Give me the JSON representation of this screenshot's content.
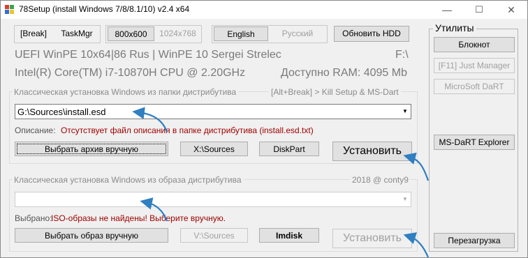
{
  "window": {
    "title": "78Setup (install Windows 7/8/8.1/10) v2.4 x64",
    "minimize_glyph": "—",
    "maximize_glyph": "☐",
    "close_glyph": "✕"
  },
  "toolbar": {
    "break_label": "[Break]",
    "taskmgr_label": "TaskMgr",
    "res1_label": "800x600",
    "res2_label": "1024x768",
    "lang1_label": "English",
    "lang2_label": "Русский",
    "update_hdd_label": "Обновить HDD"
  },
  "info": {
    "line1_left": "UEFI WinPE 10x64|86 Rus | WinPE 10 Sergei Strelec",
    "line1_right": "F:\\",
    "line2_left": "Intel(R) Core(TM) i7-10870H CPU @ 2.20GHz",
    "line2_right": "Доступно RAM: 4095 Mb"
  },
  "folder_group": {
    "legend_left": "Классическая установка Windows из папки дистрибутива",
    "legend_right": "[Alt+Break] > Kill Setup & MS-Dart",
    "path_value": "G:\\Sources\\install.esd",
    "desc_label": "Описание:",
    "desc_text": "Отсутствует файл описания в папке дистрибутива (install.esd.txt)",
    "choose_label": "Выбрать архив вручную",
    "sources_label": "X:\\Sources",
    "diskpart_label": "DiskPart",
    "install_label": "Установить"
  },
  "image_group": {
    "legend_left": "Классическая установка Windows из образа дистрибутива",
    "legend_right": "2018 @ conty9",
    "path_value": "",
    "selected_label": "Выбрано:",
    "selected_text": "ISO-образы не найдены! Выберите вручную.",
    "choose_label": "Выбрать образ вручную",
    "sources_label": "V:\\Sources",
    "imdisk_label": "Imdisk",
    "install_label": "Установить"
  },
  "utilities": {
    "title": "Утилиты",
    "notepad_label": "Блокнот",
    "just_manager_label": "[F11]  Just Manager",
    "msdart_label": "MicroSoft DaRT",
    "msdart_explorer_label": "MS-DaRT Explorer",
    "reboot_label": "Перезагрузка"
  },
  "colors": {
    "accent": "#0078d7",
    "annotation_arrow": "#2f7fc1",
    "error_text": "#a00000",
    "info_text": "#7a7a7a"
  }
}
